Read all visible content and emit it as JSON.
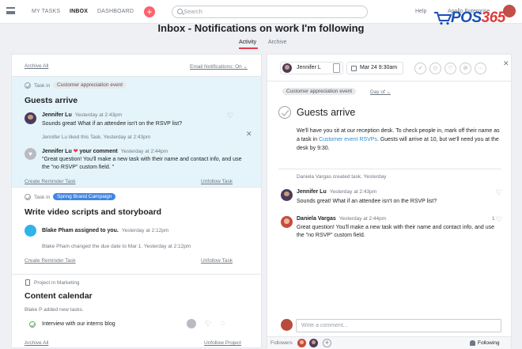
{
  "nav": {
    "tabs": [
      "MY TASKS",
      "INBOX",
      "DASHBOARD"
    ],
    "search_placeholder": "Search",
    "help": "Help",
    "user": "Apollo Enterprise"
  },
  "logo": {
    "main": "POS",
    "accent": "365"
  },
  "header": {
    "title": "Inbox - Notifications on work I'm following",
    "tabs": [
      "Activity",
      "Archive"
    ]
  },
  "left": {
    "archive_all": "Archive All",
    "email_notifications": "Email Notifications: On ⌄",
    "card1": {
      "task_in": "Task in",
      "project": "Customer appreciation event",
      "title": "Guests arrive",
      "comment1": {
        "author": "Jennifer Lu",
        "time": "Yesterday at 2:43pm",
        "text": "Sounds great! What if an attendee isn't on the RSVP list?"
      },
      "liked_meta": "Jennifer Lu liked this Task.  Yesterday at 2:43pm",
      "comment2": {
        "author": "Jennifer Lu",
        "heart": "❤",
        "action": "your comment",
        "time": "Yesterday at 2:44pm",
        "text": "\"Great question! You'll make a new task with their name and contact info, and use the \"no RSVP\" custom field. \""
      },
      "create_reminder": "Create Reminder Task",
      "unfollow": "Unfollow Task"
    },
    "card2": {
      "task_in": "Task in",
      "project": "Spring Brand Campaign",
      "title": "Write video scripts and storyboard",
      "assign": {
        "author": "Blake Pham assigned to you.",
        "time": "Yesterday at 2:12pm"
      },
      "due_meta": "Blake Pham changed the due date to Mar 1.  Yesterday at 2:12pm",
      "create_reminder": "Create Reminder Task",
      "unfollow": "Unfollow Task"
    },
    "card3": {
      "project_in": "Project in Marketing",
      "title": "Content calendar",
      "added_meta": "Blake P added new tasks.",
      "task_row": "Interview with our interns blog",
      "archive_all": "Archive All",
      "unfollow": "Unfollow Project"
    }
  },
  "right": {
    "assignee": "Jennifer L",
    "date": "Mar 24 9:30am",
    "project_tag": "Customer appreciation event",
    "field": "Day of ⌄",
    "title": "Guests arrive",
    "desc_before": "We'll have you sit at our reception desk. To check people in, mark off their name as a task in ",
    "desc_link": "Customer event RSVPs",
    "desc_after": ". Guests will arrive at 10, but we'll need you at the desk by 9:30.",
    "created_meta": "Daniela Vargas created task.  Yesterday",
    "comments": [
      {
        "author": "Jennifer Lu",
        "time": "Yesterday at 2:43pm",
        "text": "Sounds great! What if an attendee isn't on the RSVP list?"
      },
      {
        "author": "Daniela Vargas",
        "time": "Yesterday at 2:44pm",
        "text": "Great question! You'll make a new task with their name and contact info, and use the \"no RSVP\" custom field.",
        "likes": "1"
      }
    ],
    "comment_placeholder": "Write a comment...",
    "followers_label": "Followers",
    "following_label": "Following"
  },
  "colors": {
    "accent_red": "#e8384f",
    "highlight": "#e4f4fa",
    "link_blue": "#2b8fd6",
    "brand_blue": "#1a4fb4",
    "brand_red": "#e23a3a"
  }
}
